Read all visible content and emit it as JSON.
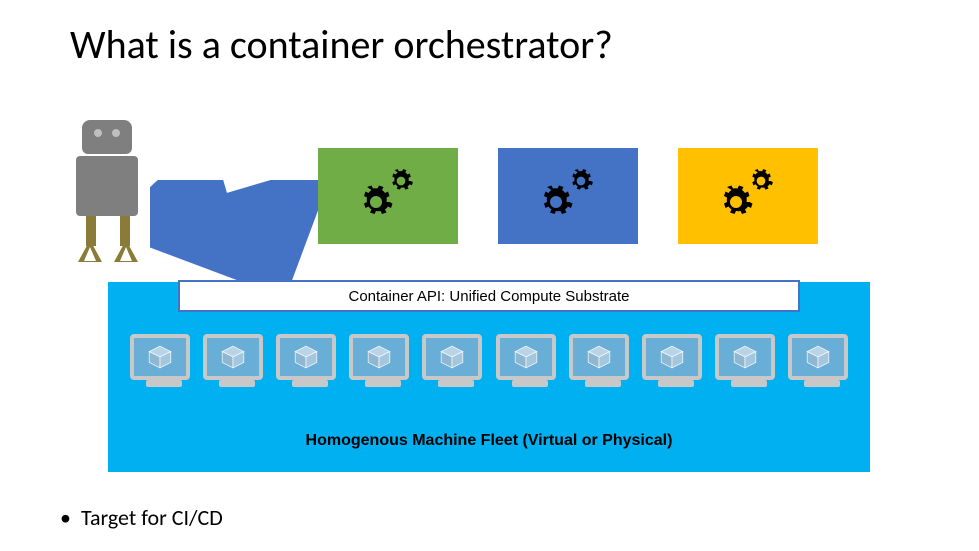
{
  "title": "What is a container orchestrator?",
  "api_label": "Container API: Unified Compute Substrate",
  "fleet_label": "Homogenous Machine Fleet (Virtual or Physical)",
  "bullet": "Target for CI/CD",
  "box_colors": {
    "a": "#70ad47",
    "b": "#4472c4",
    "c": "#ffc000"
  },
  "substrate_color": "#00b0f0",
  "machine_count": 10
}
